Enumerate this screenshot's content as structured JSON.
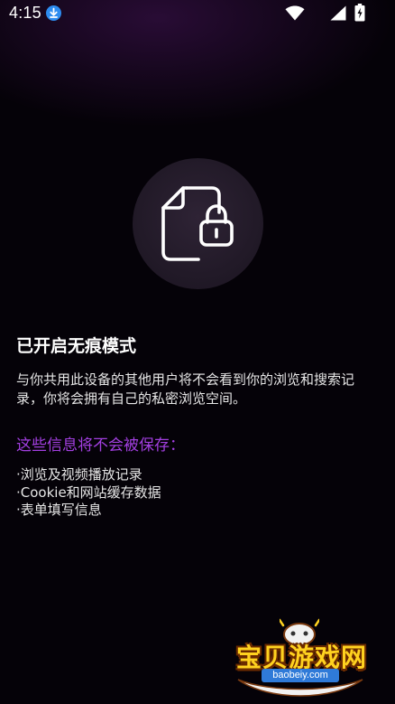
{
  "status_bar": {
    "time": "4:15",
    "icons": [
      "download-icon",
      "wifi-icon",
      "signal-icon",
      "battery-charging-icon"
    ]
  },
  "hero": {
    "icon": "file-lock-icon"
  },
  "content": {
    "title": "已开启无痕模式",
    "description": "与你共用此设备的其他用户将不会看到你的浏览和搜索记录，你将会拥有自己的私密浏览空间。",
    "subheading": "这些信息将不会被保存：",
    "items": [
      "·浏览及视频播放记录",
      "·Cookie和网站缓存数据",
      "·表单填写信息"
    ]
  },
  "watermark": {
    "brand": "宝贝游戏网",
    "url": "baobeiy.com"
  },
  "colors": {
    "background": "#050208",
    "accent_purple": "#a23fe0",
    "icon_circle": "#261d2c",
    "download_badge": "#2d8cf0"
  }
}
